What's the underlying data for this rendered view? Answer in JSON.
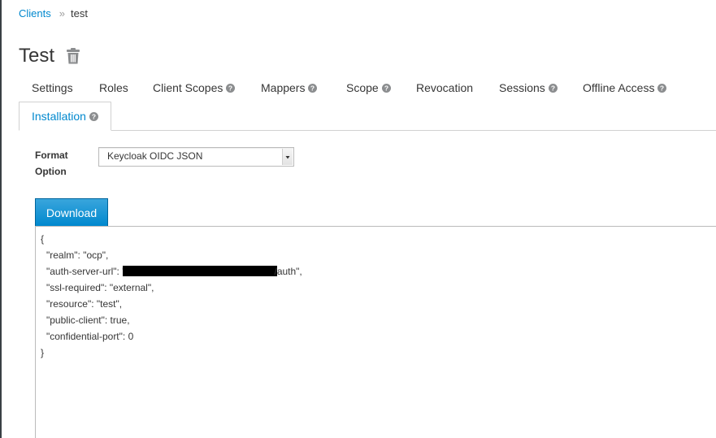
{
  "breadcrumb": {
    "parent": "Clients",
    "separator": "»",
    "current": "test"
  },
  "header": {
    "title": "Test",
    "delete_icon": "trash-icon"
  },
  "tabs": [
    {
      "label": "Settings",
      "help": false
    },
    {
      "label": "Roles",
      "help": false
    },
    {
      "label": "Client Scopes",
      "help": true
    },
    {
      "label": "Mappers",
      "help": true
    },
    {
      "label": "Scope",
      "help": true
    },
    {
      "label": "Revocation",
      "help": false
    },
    {
      "label": "Sessions",
      "help": true
    },
    {
      "label": "Offline Access",
      "help": true
    },
    {
      "label": "Installation",
      "help": true,
      "active": true
    }
  ],
  "form": {
    "format_label": "Format Option",
    "format_value": "Keycloak OIDC JSON"
  },
  "actions": {
    "download_label": "Download"
  },
  "installation": {
    "open": "{",
    "lines": [
      "\"realm\": \"ocp\",",
      "\"auth-server-url\": \"",
      "/auth\",",
      "\"ssl-required\": \"external\",",
      "\"resource\": \"test\",",
      "\"public-client\": true,",
      "\"confidential-port\": 0"
    ],
    "close": "}"
  },
  "colors": {
    "link": "#0088ce",
    "primary_button": "#0088ce",
    "text": "#363636",
    "icon_gray": "#8b8d8f",
    "left_rule": "#393f44"
  }
}
